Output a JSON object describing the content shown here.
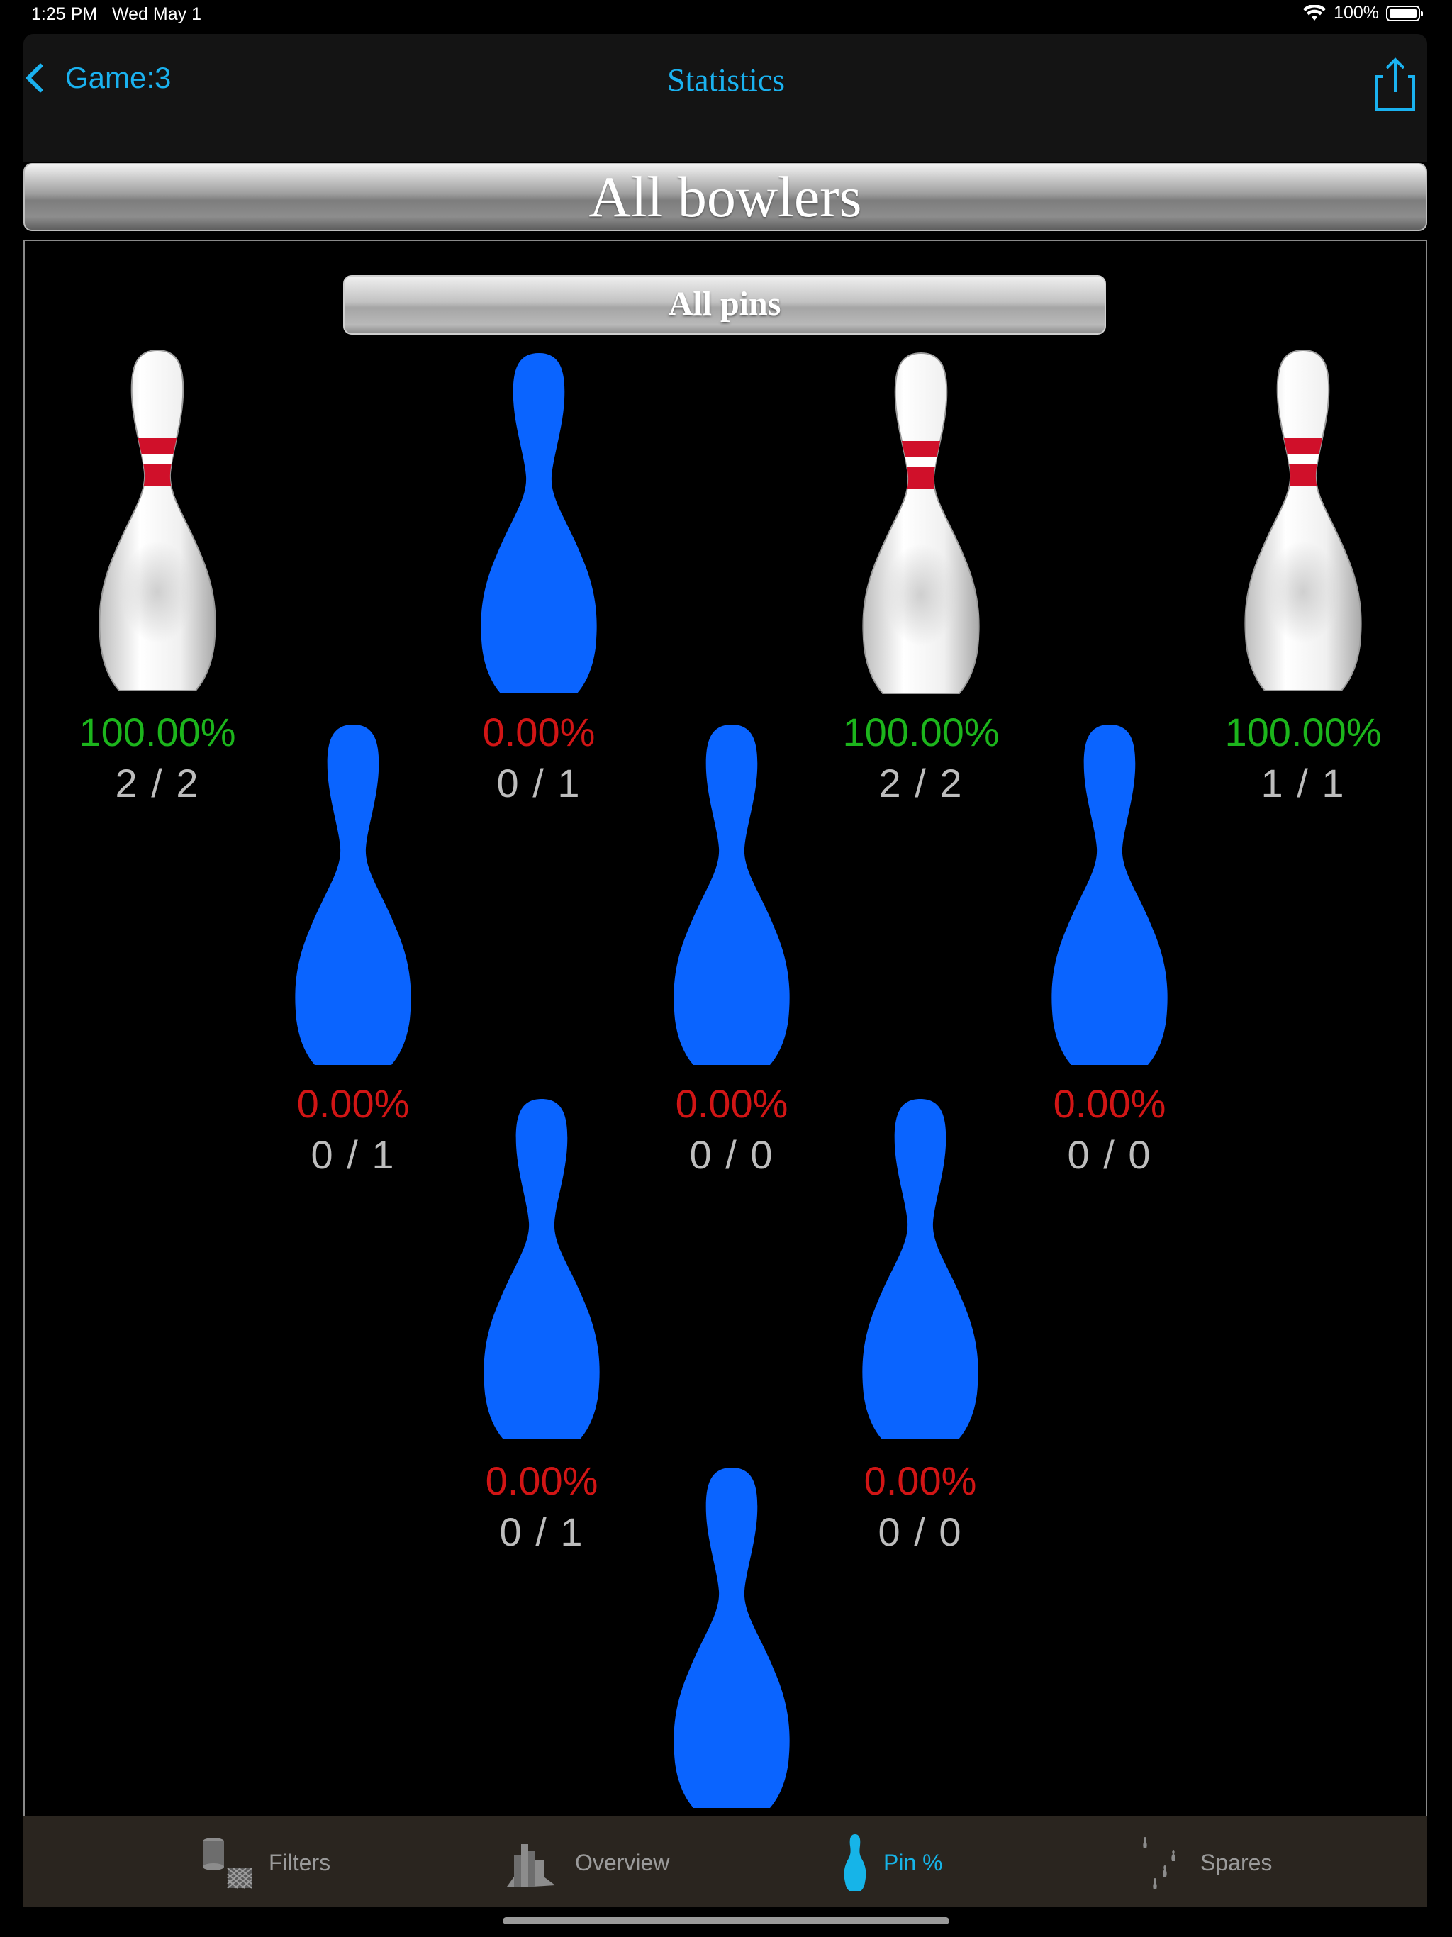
{
  "status": {
    "time": "1:25 PM",
    "date": "Wed May 1",
    "battery": "100%"
  },
  "nav": {
    "back_label": "Game:3",
    "title": "Statistics"
  },
  "header": {
    "bowlers": "All bowlers",
    "pins": "All pins"
  },
  "pins": [
    {
      "number": 7,
      "pct": "100.00%",
      "count": "2 / 2",
      "standing": true
    },
    {
      "number": 8,
      "pct": "0.00%",
      "count": "0 / 1",
      "standing": false
    },
    {
      "number": 9,
      "pct": "100.00%",
      "count": "2 / 2",
      "standing": true
    },
    {
      "number": 10,
      "pct": "100.00%",
      "count": "1 / 1",
      "standing": true
    },
    {
      "number": 4,
      "pct": "0.00%",
      "count": "0 / 1",
      "standing": false
    },
    {
      "number": 5,
      "pct": "0.00%",
      "count": "0 / 0",
      "standing": false
    },
    {
      "number": 6,
      "pct": "0.00%",
      "count": "0 / 0",
      "standing": false
    },
    {
      "number": 2,
      "pct": "0.00%",
      "count": "0 / 1",
      "standing": false
    },
    {
      "number": 3,
      "pct": "0.00%",
      "count": "0 / 0",
      "standing": false
    },
    {
      "number": 1,
      "pct": "",
      "count": "",
      "standing": false
    }
  ],
  "colors": {
    "accent": "#1ab2f0",
    "good": "#1cb51c",
    "bad": "#d11515",
    "pin_blue": "#0a64ff",
    "count_gray": "#bdbdbd"
  },
  "tabs": [
    {
      "label": "Filters",
      "icon": "filter-icon",
      "active": false
    },
    {
      "label": "Overview",
      "icon": "overview-icon",
      "active": false
    },
    {
      "label": "Pin %",
      "icon": "pin-icon",
      "active": true
    },
    {
      "label": "Spares",
      "icon": "spares-icon",
      "active": false
    }
  ]
}
